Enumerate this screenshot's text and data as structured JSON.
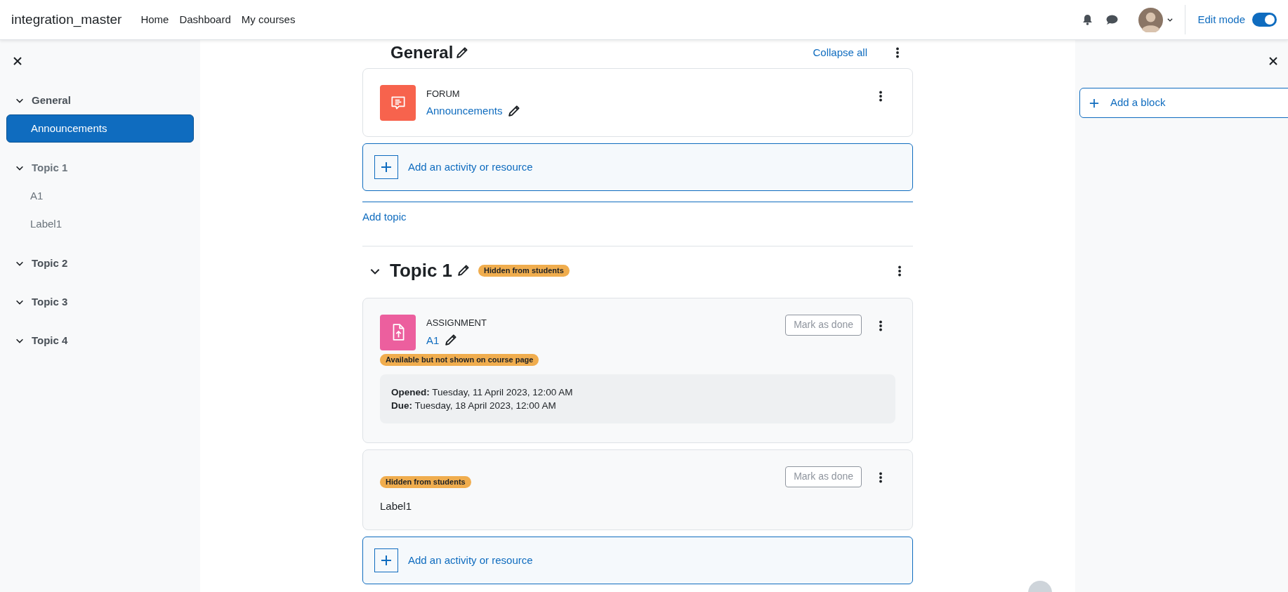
{
  "navbar": {
    "site_name": "integration_master",
    "links": [
      {
        "label": "Home"
      },
      {
        "label": "Dashboard"
      },
      {
        "label": "My courses"
      }
    ],
    "edit_mode": {
      "label": "Edit mode",
      "on": true
    }
  },
  "course_index": {
    "sections": [
      {
        "title": "General",
        "expanded": true,
        "dimmed": false,
        "items": [
          {
            "title": "Announcements",
            "selected": true,
            "dimmed": false
          }
        ]
      },
      {
        "title": "Topic 1",
        "expanded": true,
        "dimmed": true,
        "items": [
          {
            "title": "A1",
            "selected": false,
            "dimmed": true
          },
          {
            "title": "Label1",
            "selected": false,
            "dimmed": true
          }
        ]
      },
      {
        "title": "Topic 2",
        "expanded": true,
        "dimmed": false
      },
      {
        "title": "Topic 3",
        "expanded": true,
        "dimmed": false
      },
      {
        "title": "Topic 4",
        "expanded": true,
        "dimmed": false
      }
    ]
  },
  "content": {
    "sections": [
      {
        "title": "General",
        "collapse_all": "Collapse all",
        "activities": [
          {
            "kind": "forum",
            "type_label": "FORUM",
            "name": "Announcements"
          }
        ],
        "add_activity": "Add an activity or resource",
        "add_topic": "Add topic"
      },
      {
        "title": "Topic 1",
        "expanded": true,
        "badge": "Hidden from students",
        "activities": [
          {
            "kind": "assignment",
            "type_label": "ASSIGNMENT",
            "name": "A1",
            "badge": "Available but not shown on course page",
            "mark_done": "Mark as done",
            "dates": [
              {
                "label": "Opened:",
                "value": "Tuesday, 11 April 2023, 12:00 AM"
              },
              {
                "label": "Due:",
                "value": "Tuesday, 18 April 2023, 12:00 AM"
              }
            ]
          },
          {
            "kind": "label",
            "badge": "Hidden from students",
            "text": "Label1",
            "mark_done": "Mark as done"
          }
        ],
        "add_activity": "Add an activity or resource"
      }
    ]
  },
  "block_drawer": {
    "add_block": "Add a block"
  }
}
